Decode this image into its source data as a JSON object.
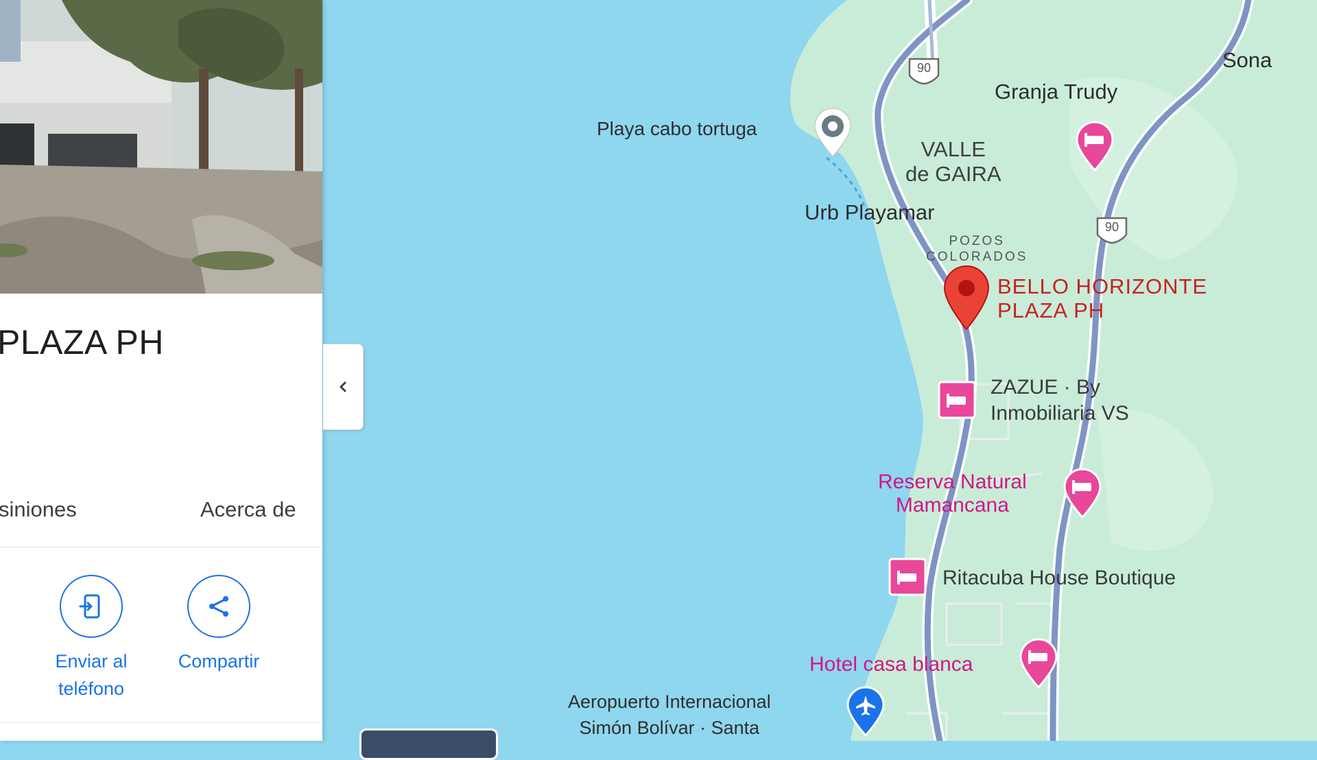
{
  "place": {
    "title": "PLAZA PH",
    "tabs": {
      "reviews": "siniones",
      "about": "Acerca de"
    },
    "actions": [
      {
        "label": "Enviar al\nteléfono",
        "icon": "send-to-phone-icon"
      },
      {
        "label": "Compartir",
        "icon": "share-icon"
      }
    ]
  },
  "map": {
    "labels": {
      "sona": "Sona",
      "granja_trudy": "Granja Trudy",
      "playa": "Playa cabo tortuga",
      "valle": "VALLE\nde GAIRA",
      "urb": "Urb Playamar",
      "pozos": "POZOS\nCOLORADOS",
      "selected_place": "BELLO HORIZONTE\nPLAZA PH",
      "zazue": "ZAZUE · By\nInmobiliaria VS",
      "reserva": "Reserva Natural\nMamancana",
      "ritacuba": "Ritacuba House Boutique",
      "hotel_casa_blanca": "Hotel casa blanca",
      "airport": "Aeropuerto Internacional\nSimón Bolívar · Santa"
    },
    "road_shields": [
      "90",
      "90"
    ],
    "colors": {
      "water": "#8fd6ef",
      "land": "#c8ecd8",
      "road": "#7e95c4",
      "selected_pin": "#ea4335",
      "lodging": "#e8479a",
      "accent": "#1a73e8"
    }
  }
}
